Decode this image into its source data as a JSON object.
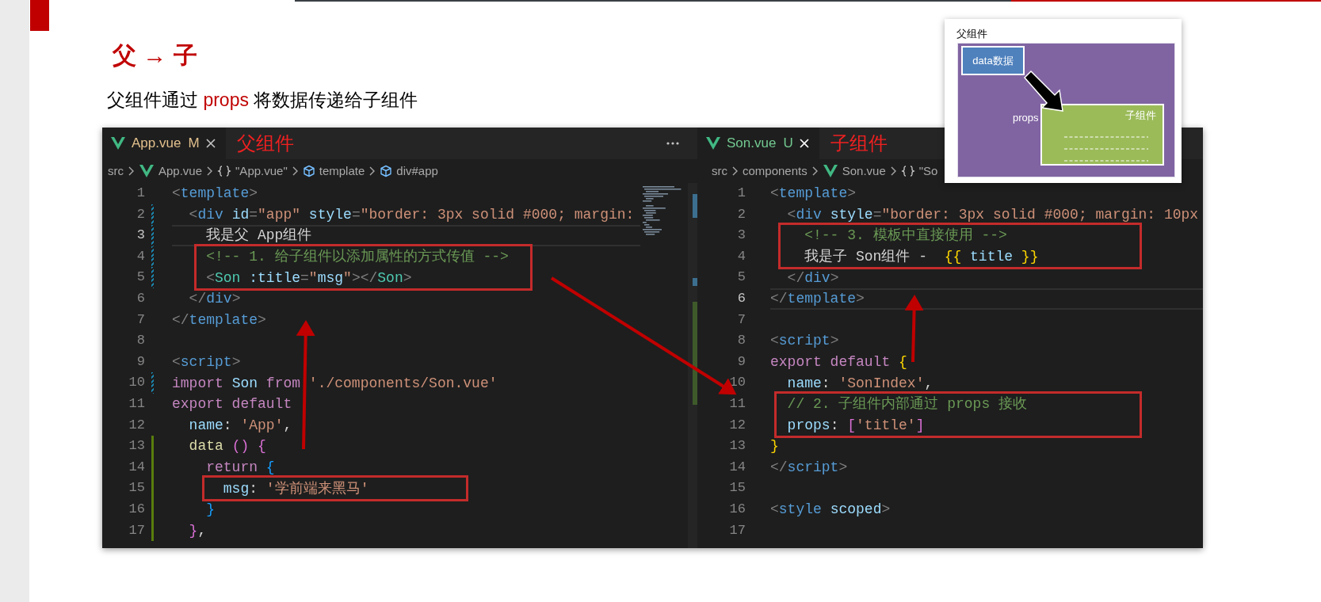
{
  "slide": {
    "title": "父 → 子",
    "subtitle": [
      {
        "text": "父组件通过 ",
        "highlight": false
      },
      {
        "text": "props",
        "highlight": true
      },
      {
        "text": " 将数据传递给子组件",
        "highlight": false
      }
    ]
  },
  "editors": [
    {
      "tab": {
        "file": "App.vue",
        "badge": "M",
        "kind": "modified"
      },
      "annotation": "父组件",
      "actions_menu": true,
      "minimap": true,
      "breadcrumbs": [
        {
          "label": "src",
          "kind": "folder"
        },
        {
          "label": "App.vue",
          "kind": "vue"
        },
        {
          "label": "\"App.vue\"",
          "kind": "braces"
        },
        {
          "label": "template",
          "kind": "cube"
        },
        {
          "label": "div#app",
          "kind": "cube"
        }
      ],
      "lines": [
        {
          "number": "1",
          "active": false,
          "kind": "plain",
          "tokens": [
            {
              "kind": "punct",
              "text": "<"
            },
            {
              "kind": "tag",
              "text": "template"
            },
            {
              "kind": "punct",
              "text": ">"
            }
          ]
        },
        {
          "number": "2",
          "active": false,
          "kind": "modified",
          "tokens": [
            {
              "kind": "punct",
              "text": "  <"
            },
            {
              "kind": "tag",
              "text": "div "
            },
            {
              "kind": "attr",
              "text": "id"
            },
            {
              "kind": "punct",
              "text": "="
            },
            {
              "kind": "string",
              "text": "\"app\" "
            },
            {
              "kind": "attr",
              "text": "style"
            },
            {
              "kind": "punct",
              "text": "="
            },
            {
              "kind": "string",
              "text": "\"border: 3px solid #000; margin:"
            }
          ]
        },
        {
          "number": "3",
          "active": true,
          "kind": "modified",
          "tokens": [
            {
              "kind": "text",
              "text": "    我是父 App组件"
            }
          ]
        },
        {
          "number": "4",
          "active": false,
          "kind": "modified",
          "tokens": [
            {
              "kind": "comment",
              "text": "    <!-- 1. 给子组件以添加属性的方式传值 -->"
            }
          ]
        },
        {
          "number": "5",
          "active": false,
          "kind": "modified",
          "tokens": [
            {
              "kind": "punct",
              "text": "    <"
            },
            {
              "kind": "component",
              "text": "Son "
            },
            {
              "kind": "attr",
              "text": ":title"
            },
            {
              "kind": "punct",
              "text": "="
            },
            {
              "kind": "string",
              "text": "\""
            },
            {
              "kind": "attr",
              "text": "msg"
            },
            {
              "kind": "string",
              "text": "\""
            },
            {
              "kind": "punct",
              "text": "></"
            },
            {
              "kind": "component",
              "text": "Son"
            },
            {
              "kind": "punct",
              "text": ">"
            }
          ]
        },
        {
          "number": "6",
          "active": false,
          "kind": "plain",
          "tokens": [
            {
              "kind": "punct",
              "text": "  </"
            },
            {
              "kind": "tag",
              "text": "div"
            },
            {
              "kind": "punct",
              "text": ">"
            }
          ]
        },
        {
          "number": "7",
          "active": false,
          "kind": "plain",
          "tokens": [
            {
              "kind": "punct",
              "text": "</"
            },
            {
              "kind": "tag",
              "text": "template"
            },
            {
              "kind": "punct",
              "text": ">"
            }
          ]
        },
        {
          "number": "8",
          "active": false,
          "kind": "plain"
        },
        {
          "number": "9",
          "active": false,
          "kind": "plain",
          "tokens": [
            {
              "kind": "punct",
              "text": "<"
            },
            {
              "kind": "tag",
              "text": "script"
            },
            {
              "kind": "punct",
              "text": ">"
            }
          ]
        },
        {
          "number": "10",
          "active": false,
          "kind": "modified",
          "tokens": [
            {
              "kind": "keyword",
              "text": "import "
            },
            {
              "kind": "attr",
              "text": "Son "
            },
            {
              "kind": "keyword",
              "text": "from "
            },
            {
              "kind": "string",
              "text": "'./components/Son.vue'"
            }
          ]
        },
        {
          "number": "11",
          "active": false,
          "kind": "plain",
          "tokens": [
            {
              "kind": "keyword",
              "text": "export default"
            }
          ]
        },
        {
          "number": "12",
          "active": false,
          "kind": "plain",
          "tokens": [
            {
              "kind": "attr",
              "text": "  name"
            },
            {
              "kind": "text",
              "text": ": "
            },
            {
              "kind": "string",
              "text": "'App'"
            },
            {
              "kind": "text",
              "text": ","
            }
          ]
        },
        {
          "number": "13",
          "active": false,
          "kind": "added",
          "tokens": [
            {
              "kind": "func",
              "text": "  data "
            },
            {
              "kind": "bracket2",
              "text": "() {"
            }
          ]
        },
        {
          "number": "14",
          "active": false,
          "kind": "added",
          "tokens": [
            {
              "kind": "keyword",
              "text": "    return "
            },
            {
              "kind": "bracket3",
              "text": "{"
            }
          ]
        },
        {
          "number": "15",
          "active": false,
          "kind": "added",
          "tokens": [
            {
              "kind": "attr",
              "text": "      msg"
            },
            {
              "kind": "text",
              "text": ": "
            },
            {
              "kind": "string",
              "text": "'学前端来黑马'"
            }
          ]
        },
        {
          "number": "16",
          "active": false,
          "kind": "added",
          "tokens": [
            {
              "kind": "bracket3",
              "text": "    }"
            }
          ]
        },
        {
          "number": "17",
          "active": false,
          "kind": "added",
          "tokens": [
            {
              "kind": "bracket2",
              "text": "  }"
            },
            {
              "kind": "text",
              "text": ","
            }
          ]
        }
      ]
    },
    {
      "tab": {
        "file": "Son.vue",
        "badge": "U",
        "kind": "untracked"
      },
      "annotation": "子组件",
      "breadcrumbs": [
        {
          "label": "src",
          "kind": "folder"
        },
        {
          "label": "components",
          "kind": "folder"
        },
        {
          "label": "Son.vue",
          "kind": "vue"
        },
        {
          "label": "\"So",
          "kind": "braces"
        }
      ],
      "lines": [
        {
          "number": "1",
          "active": false,
          "kind": "plain",
          "tokens": [
            {
              "kind": "punct",
              "text": "<"
            },
            {
              "kind": "tag",
              "text": "template"
            },
            {
              "kind": "punct",
              "text": ">"
            }
          ]
        },
        {
          "number": "2",
          "active": false,
          "kind": "plain",
          "tokens": [
            {
              "kind": "punct",
              "text": "  <"
            },
            {
              "kind": "tag",
              "text": "div "
            },
            {
              "kind": "attr",
              "text": "style"
            },
            {
              "kind": "punct",
              "text": "="
            },
            {
              "kind": "string",
              "text": "\"border: 3px solid #000; margin: 10px"
            }
          ]
        },
        {
          "number": "3",
          "active": false,
          "kind": "plain",
          "tokens": [
            {
              "kind": "comment",
              "text": "    <!-- 3. 模板中直接使用 -->"
            }
          ]
        },
        {
          "number": "4",
          "active": false,
          "kind": "plain",
          "tokens": [
            {
              "kind": "text",
              "text": "    我是子 Son组件 -  "
            },
            {
              "kind": "bracket1",
              "text": "{{ "
            },
            {
              "kind": "attr",
              "text": "title "
            },
            {
              "kind": "bracket1",
              "text": "}}"
            }
          ]
        },
        {
          "number": "5",
          "active": false,
          "kind": "plain",
          "tokens": [
            {
              "kind": "punct",
              "text": "  </"
            },
            {
              "kind": "tag",
              "text": "div"
            },
            {
              "kind": "punct",
              "text": ">"
            }
          ]
        },
        {
          "number": "6",
          "active": true,
          "kind": "plain",
          "tokens": [
            {
              "kind": "punct",
              "text": "</"
            },
            {
              "kind": "tag",
              "text": "template"
            },
            {
              "kind": "punct",
              "text": ">"
            }
          ]
        },
        {
          "number": "7",
          "active": false,
          "kind": "plain"
        },
        {
          "number": "8",
          "active": false,
          "kind": "plain",
          "tokens": [
            {
              "kind": "punct",
              "text": "<"
            },
            {
              "kind": "tag",
              "text": "script"
            },
            {
              "kind": "punct",
              "text": ">"
            }
          ]
        },
        {
          "number": "9",
          "active": false,
          "kind": "plain",
          "tokens": [
            {
              "kind": "keyword",
              "text": "export default "
            },
            {
              "kind": "bracket1",
              "text": "{"
            }
          ]
        },
        {
          "number": "10",
          "active": false,
          "kind": "plain",
          "tokens": [
            {
              "kind": "attr",
              "text": "  name"
            },
            {
              "kind": "text",
              "text": ": "
            },
            {
              "kind": "string",
              "text": "'SonIndex'"
            },
            {
              "kind": "text",
              "text": ","
            }
          ]
        },
        {
          "number": "11",
          "active": false,
          "kind": "plain",
          "tokens": [
            {
              "kind": "comment",
              "text": "  // 2. 子组件内部通过 props 接收"
            }
          ]
        },
        {
          "number": "12",
          "active": false,
          "kind": "plain",
          "tokens": [
            {
              "kind": "attr",
              "text": "  props"
            },
            {
              "kind": "text",
              "text": ": "
            },
            {
              "kind": "bracket2",
              "text": "["
            },
            {
              "kind": "string",
              "text": "'title'"
            },
            {
              "kind": "bracket2",
              "text": "]"
            }
          ]
        },
        {
          "number": "13",
          "active": false,
          "kind": "plain",
          "tokens": [
            {
              "kind": "bracket1",
              "text": "}"
            }
          ]
        },
        {
          "number": "14",
          "active": false,
          "kind": "plain",
          "tokens": [
            {
              "kind": "punct",
              "text": "</"
            },
            {
              "kind": "tag",
              "text": "script"
            },
            {
              "kind": "punct",
              "text": ">"
            }
          ]
        },
        {
          "number": "15",
          "active": false,
          "kind": "plain"
        },
        {
          "number": "16",
          "active": false,
          "kind": "plain",
          "tokens": [
            {
              "kind": "punct",
              "text": "<"
            },
            {
              "kind": "tag",
              "text": "style "
            },
            {
              "kind": "attr",
              "text": "scoped"
            },
            {
              "kind": "punct",
              "text": ">"
            }
          ]
        },
        {
          "number": "17",
          "active": false,
          "kind": "plain"
        }
      ]
    }
  ],
  "diagram": {
    "title": "父组件",
    "source_label": "data数据",
    "arrow_label": "props",
    "target_label": "子组件"
  }
}
